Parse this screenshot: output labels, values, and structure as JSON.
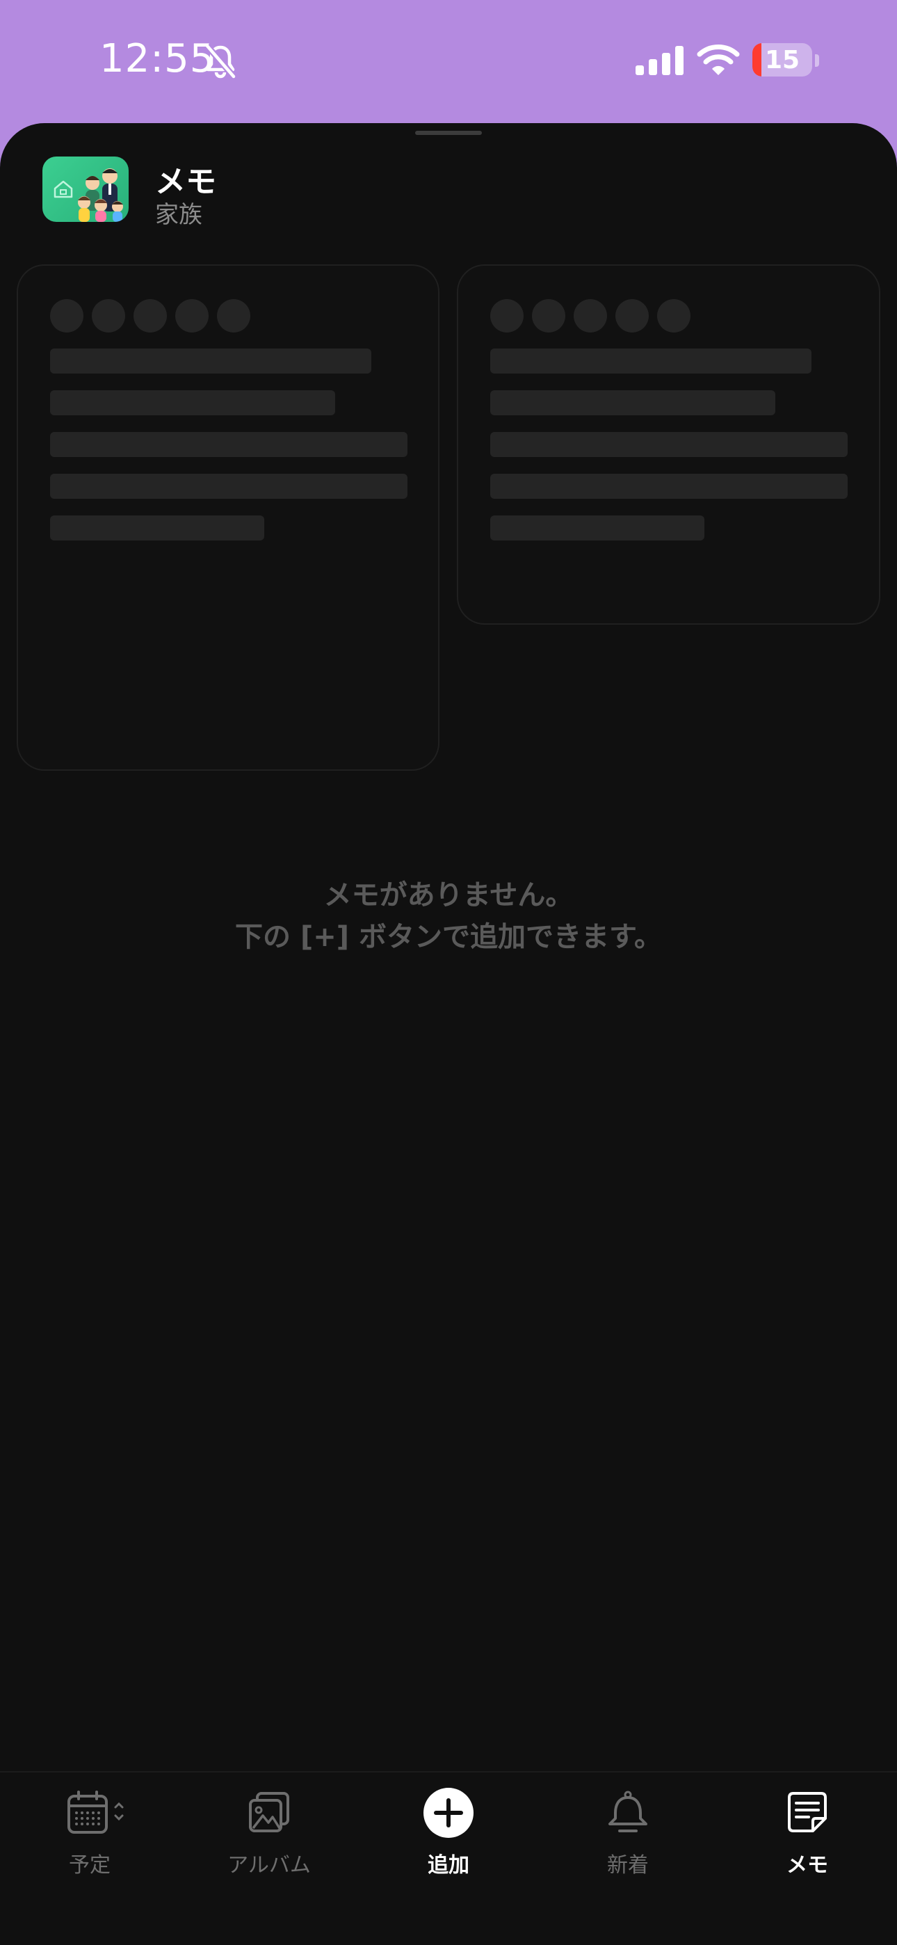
{
  "status_bar": {
    "time": "12:55",
    "battery_level": "15",
    "battery_fraction": 0.15,
    "silent_icon": "bell-slash-icon",
    "signal_icon": "cellular-signal-icon",
    "wifi_icon": "wifi-icon"
  },
  "header": {
    "title": "メモ",
    "subtitle": "家族",
    "app_icon": "family-app-icon"
  },
  "empty_state": {
    "line1": "メモがありません。",
    "line2": "下の [+] ボタンで追加できます。"
  },
  "tab_bar": {
    "tabs": [
      {
        "label": "予定",
        "icon": "calendar-icon",
        "active": false
      },
      {
        "label": "アルバム",
        "icon": "photo-album-icon",
        "active": false
      },
      {
        "label": "追加",
        "icon": "plus-circle-icon",
        "active": true
      },
      {
        "label": "新着",
        "icon": "bell-icon",
        "active": false
      },
      {
        "label": "メモ",
        "icon": "note-icon",
        "active": true
      }
    ]
  },
  "colors": {
    "status_bar_bg": "#b48ae0",
    "sheet_bg": "#101010",
    "skeleton": "#252525",
    "app_icon_green": "#3ccf91",
    "battery_low": "#ff3b30"
  }
}
